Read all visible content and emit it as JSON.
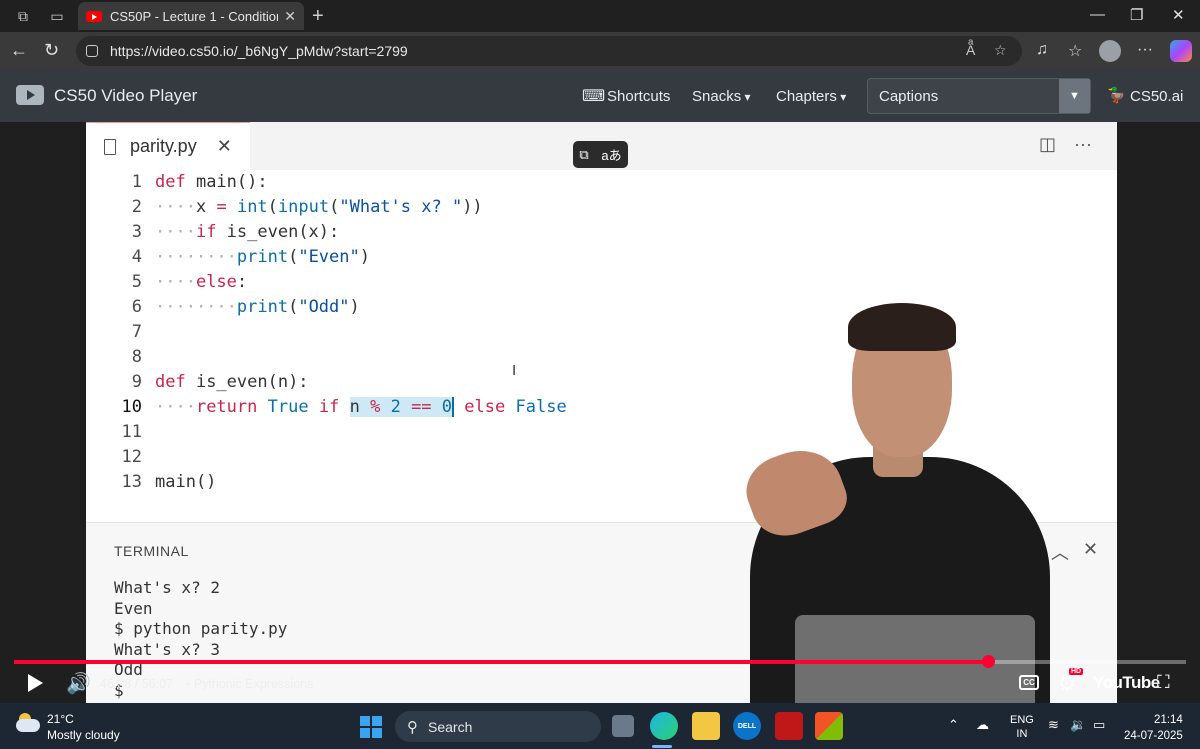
{
  "browser": {
    "tab_title": "CS50P - Lecture 1 - Conditionals",
    "url": "https://video.cs50.io/_b6NgY_pMdw?start=2799"
  },
  "player": {
    "app_title": "CS50 Video Player",
    "nav": {
      "shortcuts": "Shortcuts",
      "snacks": "Snacks",
      "chapters": "Chapters",
      "cs50ai": "CS50.ai"
    },
    "captions_value": "Captions"
  },
  "editor": {
    "filename": "parity.py",
    "line_numbers": [
      "1",
      "2",
      "3",
      "4",
      "5",
      "6",
      "7",
      "8",
      "9",
      "10",
      "11",
      "12",
      "13"
    ],
    "code": {
      "l1_kw": "def",
      "l1_rest": " main():",
      "l2_var": "x",
      "l2_eq": "=",
      "l2_fn1": "int",
      "l2_fn2": "input",
      "l2_str": "\"What's x? \"",
      "l3_kw": "if",
      "l3_rest": " is_even(x):",
      "l4_fn": "print",
      "l4_str": "\"Even\"",
      "l5_kw": "else",
      "l5_rest": ":",
      "l6_fn": "print",
      "l6_str": "\"Odd\"",
      "l9_kw": "def",
      "l9_rest": " is_even(n):",
      "l10_ret": "return",
      "l10_true": "True",
      "l10_if": "if",
      "l10_n": "n",
      "l10_mod": "%",
      "l10_two": "2",
      "l10_eqeq": "==",
      "l10_zero": "0",
      "l10_else": "else",
      "l10_false": "False",
      "l13": "main()"
    },
    "terminal_title": "TERMINAL",
    "terminal_lines": "What's x? 2\nEven\n$ python parity.py\nWhat's x? 3\nOdd\n$ "
  },
  "video": {
    "time": "46:38 / 56:07",
    "chapter": "• Pythonic Expressions",
    "progress": 0.831,
    "cc_label": "CC",
    "hd_badge": "HD",
    "brand": "YouTube"
  },
  "taskbar": {
    "temperature": "21°C",
    "condition": "Mostly cloudy",
    "search_label": "Search",
    "dell_label": "DELL",
    "lang_line1": "ENG",
    "lang_line2": "IN",
    "time": "21:14",
    "date": "24-07-2025"
  }
}
